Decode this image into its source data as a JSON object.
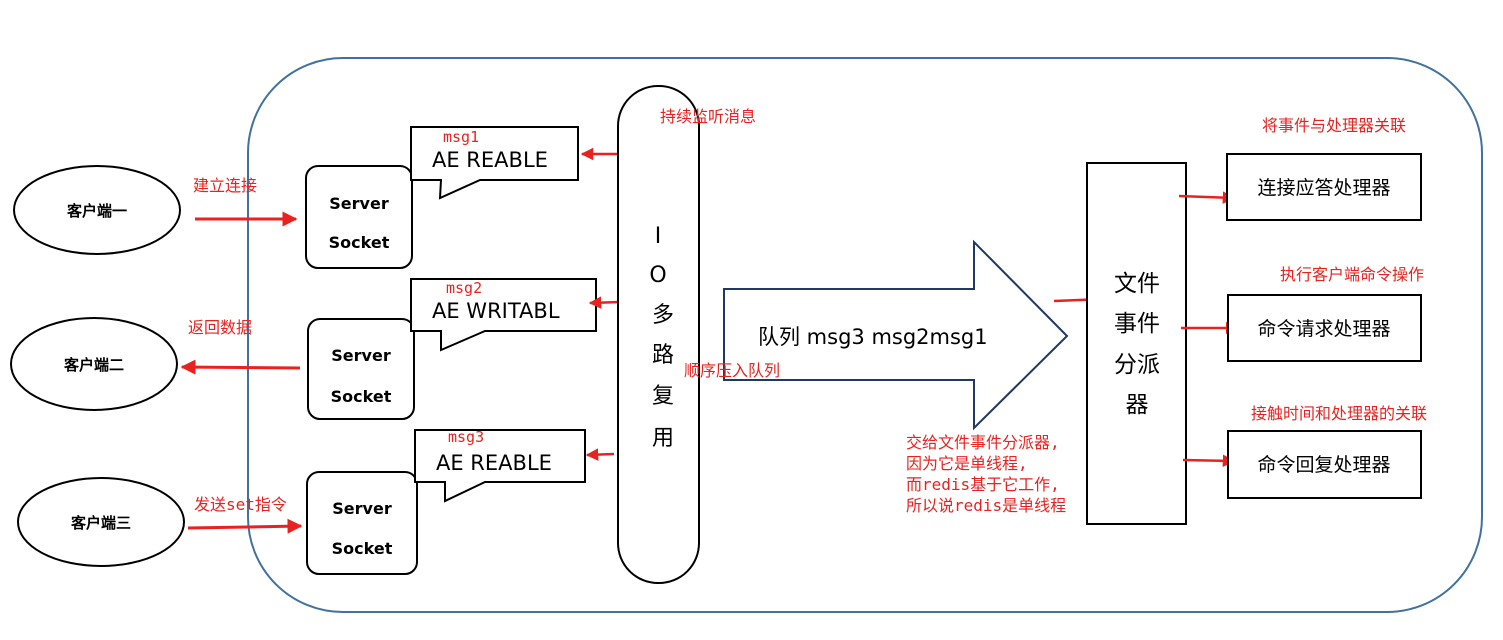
{
  "clients": [
    {
      "label": "客户端一"
    },
    {
      "label": "客户端二"
    },
    {
      "label": "客户端三"
    }
  ],
  "server_sockets": [
    {
      "line1": "Server",
      "line2": "Socket"
    },
    {
      "line1": "Server",
      "line2": "Socket"
    },
    {
      "line1": "Server",
      "line2": "Socket"
    }
  ],
  "events": [
    {
      "msg": "msg1",
      "label": "AE  REABLE"
    },
    {
      "msg": "msg2",
      "label": "AE  WRITABL"
    },
    {
      "msg": "msg3",
      "label": "AE  REABLE"
    }
  ],
  "client_actions": {
    "connect": "建立连接",
    "return_data": "返回数据",
    "send_set": "发送set指令"
  },
  "io_multiplex": {
    "chars": [
      "I",
      "O",
      "多",
      "路",
      "复",
      "用"
    ]
  },
  "listen_label": "持续监听消息",
  "queue": {
    "label": "队列 msg3 msg2msg1",
    "push_label": "顺序压入队列"
  },
  "dispatcher": {
    "chars": [
      "文件",
      "事件",
      "分派",
      "器"
    ]
  },
  "dispatch_note": [
    "交给文件事件分派器,",
    "因为它是单线程,",
    "而redis基于它工作,",
    "所以说redis是单线程"
  ],
  "handlers": [
    {
      "caption": "将事件与处理器关联",
      "label": "连接应答处理器"
    },
    {
      "caption": "执行客户端命令操作",
      "label": "命令请求处理器"
    },
    {
      "caption": "接触时间和处理器的关联",
      "label": "命令回复处理器"
    }
  ],
  "colors": {
    "annotation": "#e8231f",
    "container_border": "#41719c",
    "stroke": "#000000"
  }
}
